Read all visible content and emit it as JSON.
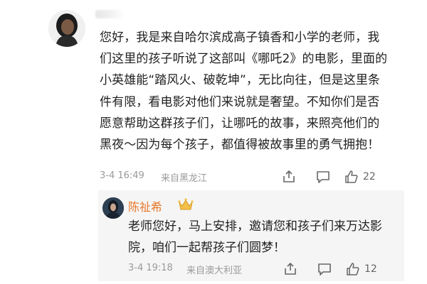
{
  "comment": {
    "text": "您好，我是来自哈尔滨成高子镇香和小学的老师，我们这里的孩子听说了这部叫《哪吒2》的电影，里面的小英雄能“踏风火、破乾坤”，无比向往，但是这里条件有限，看电影对他们来说就是奢望。不知你们是否愿意帮助这群孩子们，让哪吒的故事，来照亮他们的黑夜～因为每个孩子，都值得被故事里的勇气拥抱！",
    "time": "3-4 16:49",
    "location": "来自黑龙江",
    "like_count": "22",
    "icons": [
      "share-icon",
      "comment-icon",
      "like-icon"
    ]
  },
  "reply": {
    "username": "陈祉希",
    "badge": "crown-icon",
    "text": "老师您好，马上安排，邀请您和孩子们来万达影院，咱们一起帮孩子们圆梦！",
    "time": "3-4 19:18",
    "location": "来自澳大利亚",
    "like_count": "12",
    "icons": [
      "share-icon",
      "comment-icon",
      "like-icon"
    ]
  },
  "colors": {
    "username_accent": "#e8792b",
    "meta_gray": "#9a9a9a",
    "reply_background": "#f5f5f5"
  }
}
